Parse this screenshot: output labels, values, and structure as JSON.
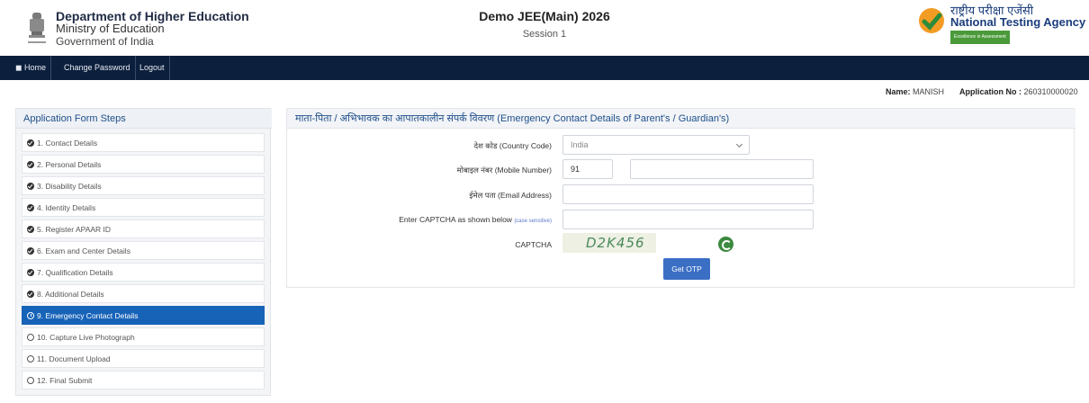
{
  "header": {
    "dept_line1": "Department of Higher Education",
    "dept_line2": "Ministry of Education",
    "dept_line3": "Government of India",
    "exam_title": "Demo JEE(Main) 2026",
    "session": "Session 1",
    "nta_hindi": "राष्ट्रीय परीक्षा एजेंसी",
    "nta_english": "National Testing Agency",
    "nta_tagline": "Excellence in Assessment"
  },
  "nav": {
    "home": "◼ Home",
    "change_password": "Change Password",
    "logout": "Logout"
  },
  "user": {
    "name_label": "Name:",
    "name_value": "MANISH",
    "app_label": "Application No :",
    "app_value": "260310000020"
  },
  "sidebar": {
    "title": "Application Form Steps",
    "steps": [
      {
        "label": "1. Contact Details",
        "status": "done"
      },
      {
        "label": "2. Personal Details",
        "status": "done"
      },
      {
        "label": "3. Disability Details",
        "status": "done"
      },
      {
        "label": "4. Identity Details",
        "status": "done"
      },
      {
        "label": "5. Register APAAR ID",
        "status": "done"
      },
      {
        "label": "6. Exam and Center Details",
        "status": "done"
      },
      {
        "label": "7. Qualification Details",
        "status": "done"
      },
      {
        "label": "8. Additional Details",
        "status": "done"
      },
      {
        "label": "9. Emergency Contact Details",
        "status": "active"
      },
      {
        "label": "10. Capture Live Photograph",
        "status": "pending"
      },
      {
        "label": "11. Document Upload",
        "status": "pending"
      },
      {
        "label": "12. Final Submit",
        "status": "pending"
      }
    ]
  },
  "form": {
    "title": "माता-पिता / अभिभावक का आपातकालीन संपर्क विवरण (Emergency Contact Details of Parent's / Guardian's)",
    "country_label": "देश कोड (Country Code)",
    "country_value": "India",
    "mobile_label": "मोबाइल नंबर (Mobile Number)",
    "mobile_code": "91",
    "mobile_value": "",
    "email_label": "ईमेल पता (Email Address)",
    "email_value": "",
    "captcha_entry_label": "Enter CAPTCHA as shown below",
    "captcha_case_note": "(case sensitive)",
    "captcha_entry_value": "",
    "captcha_label": "CAPTCHA",
    "captcha_text": "D2K456",
    "otp_button": "Get OTP"
  },
  "colors": {
    "navbar": "#0c1f3d",
    "active_step": "#1763b8",
    "title_blue": "#1f4f8b",
    "button": "#3a6fc4"
  }
}
